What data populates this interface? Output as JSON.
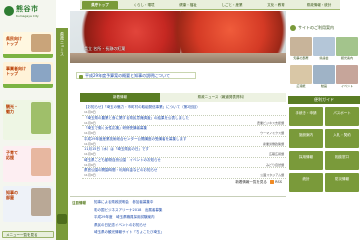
{
  "site": {
    "name": "熊谷市",
    "tagline": "Kumagaya City"
  },
  "left_tiles": [
    {
      "label": "県民向け\nトップ",
      "bg": "#fff7e0",
      "photo": "#c9a47a"
    },
    {
      "label": "事業者向け\nトップ",
      "bg": "#fff2d8",
      "photo": "#8aa5c4"
    },
    {
      "label": "観光・\n魅力",
      "bg": "#eef6e4",
      "photo": "#9fbf6a"
    },
    {
      "label": "子育て\n応援",
      "bg": "#fdeef2",
      "photo": "#e7b7a0"
    },
    {
      "label": "知事の\n部屋",
      "bg": "#eef2f8",
      "photo": "#b9a896"
    }
  ],
  "left_vbar_text": "県政ニュース",
  "bottom_menu": "メニュー一覧を見る",
  "topnav": {
    "tabs": [
      "県庁トップ",
      "くらし・環境",
      "健康・福祉",
      "しごと・産業",
      "文化・教育",
      "県政情報・統計"
    ]
  },
  "hero_caption": "県立 名所・長瀞の紅葉",
  "notice": "平成29年度予算案の概要と知事の説明について",
  "right": {
    "sitemap": "サイトのご利用案内",
    "thumbs": [
      {
        "label": "知事の部屋",
        "color": "#c8b49a"
      },
      {
        "label": "県議会",
        "color": "#b4c6d8"
      },
      {
        "label": "観光案内",
        "color": "#a3c48c"
      },
      {
        "label": "広報紙",
        "color": "#d9c7a6"
      },
      {
        "label": "動画",
        "color": "#9fb3c6"
      },
      {
        "label": "イベント",
        "color": "#c6a59a"
      }
    ],
    "guide_head": "便利ガイド",
    "guides": [
      "手続き・申請",
      "パスポート",
      "施設案内",
      "入札・契約",
      "採用情報",
      "相談窓口",
      "統計",
      "防災情報"
    ]
  },
  "news": {
    "tabs": [
      "新着情報",
      "県政ニュース（報道発表資料）"
    ],
    "items": [
      {
        "title": "【お知らせ】「埼玉の魅力・市町村の取組発信事業」について（第2回目）",
        "date": "11月9日",
        "dept": ""
      },
      {
        "title": "「埼玉県の農業と食に関する県民意識調査」の結果を公表しました",
        "date": "11月9日",
        "dept": "農業ビジネス支援課"
      },
      {
        "title": "「埼玉で働く女性応援」研修受講者募集",
        "date": "11月9日",
        "dept": "ウーマノミクス課"
      },
      {
        "title": "平成29年度産業技術総合センター公開講座の受講者を募集します",
        "date": "11月9日",
        "dept": "産業労働政策課"
      },
      {
        "title": "11月15日（水）は「埼玉県民の日」です",
        "date": "11月9日",
        "dept": "広聴広報課"
      },
      {
        "title": "埼玉県こども動物自然公園　イベントのお知らせ",
        "date": "11月9日",
        "dept": "みどり自然課"
      },
      {
        "title": "県営公園の開園時間・利用料金などのお知らせ",
        "date": "11月9日",
        "dept": "公園スタジアム課"
      }
    ],
    "more": "新着情報一覧を見る",
    "rss": "RSS"
  },
  "events": {
    "label": "注目情報",
    "items": [
      "知事による県政説明会　参加者募集中",
      "彩の国ビジネスアリーナ2018　出展者募集",
      "平成29年度　埼玉県職員採用試験案内",
      "県民の日記念イベントのお知らせ",
      "埼玉県の観光情報サイト「ちょこたび埼玉」"
    ]
  }
}
